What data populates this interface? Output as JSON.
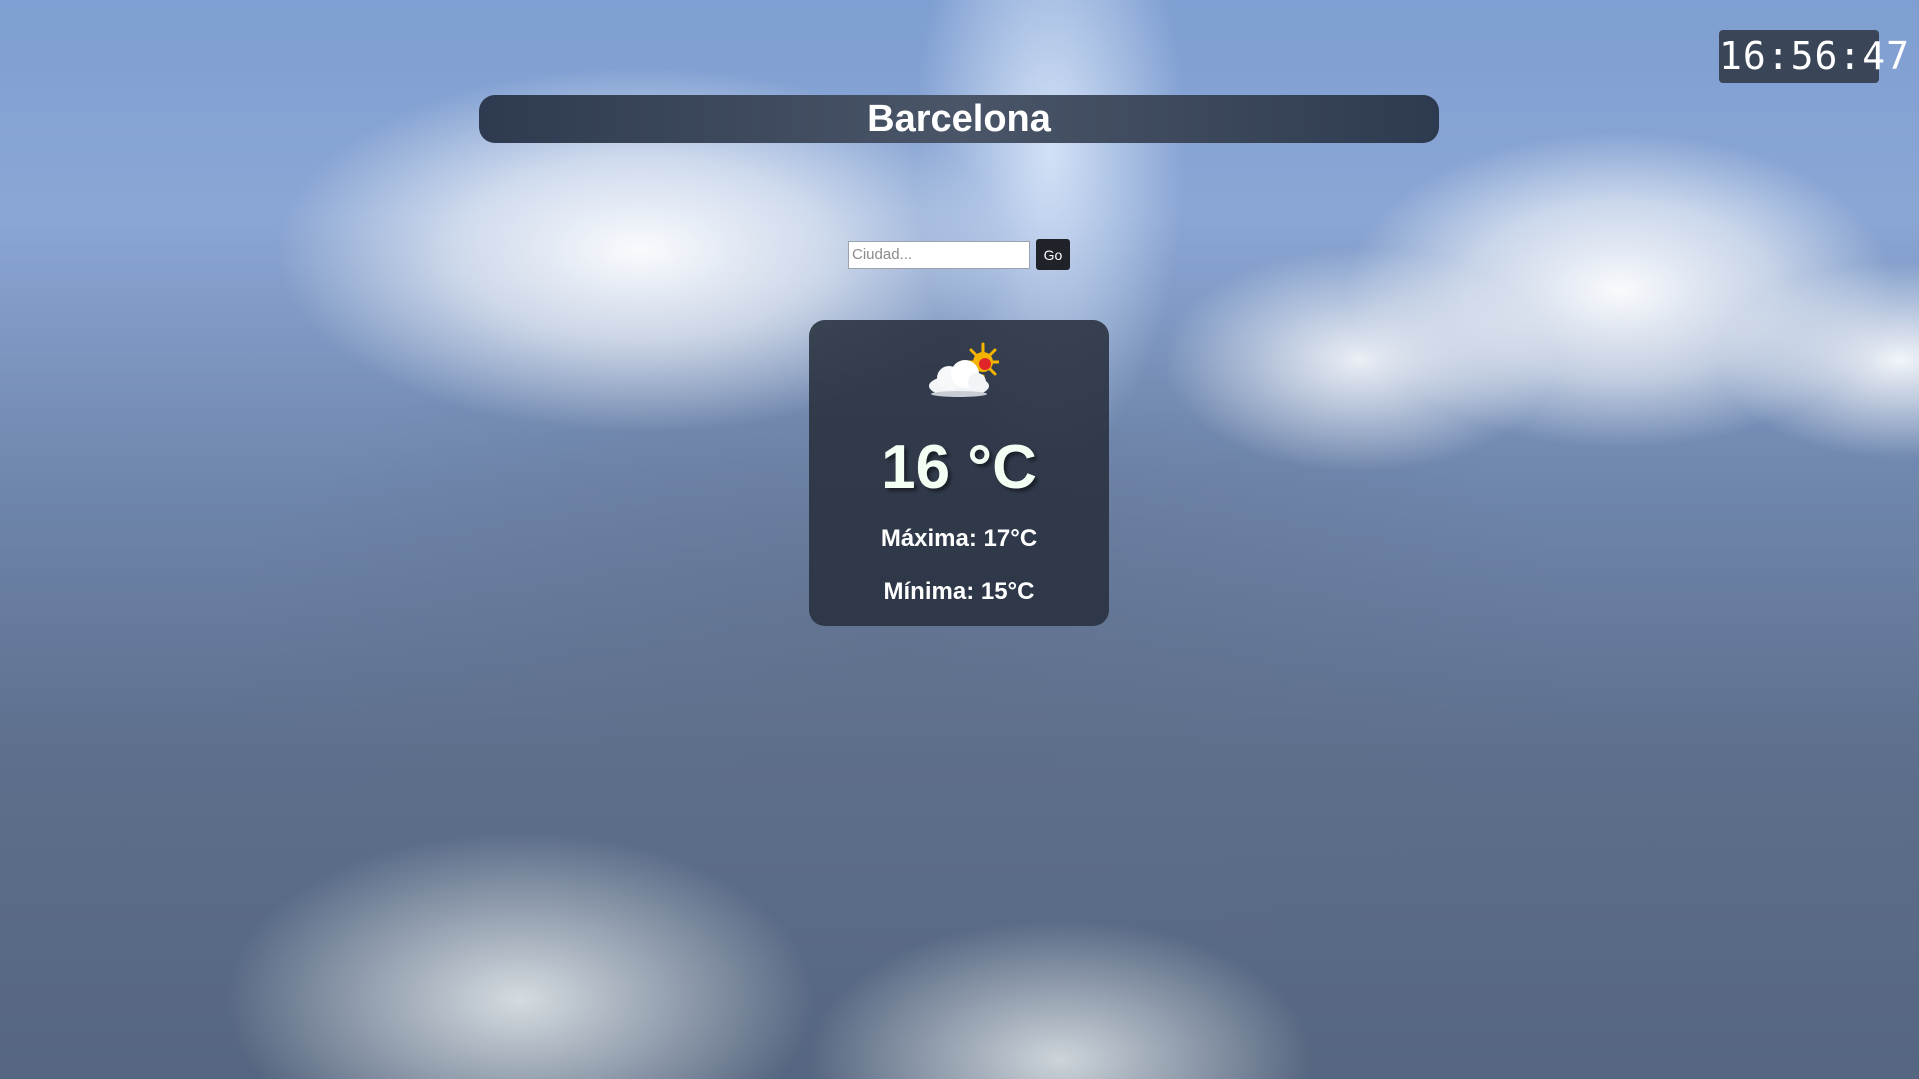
{
  "clock": {
    "time": "16:56:47"
  },
  "header": {
    "city": "Barcelona"
  },
  "search": {
    "placeholder": "Ciudad...",
    "value": "",
    "button_label": "Go"
  },
  "weather": {
    "icon": "partly-cloudy-sun-icon",
    "temperature": "16 °C",
    "max_label": "Máxima: 17°C",
    "min_label": "Mínima: 15°C"
  },
  "colors": {
    "card_background": "#28303e",
    "header_background": "#3a4658",
    "button_background": "#1f2329",
    "sun": "#f5b400",
    "sun_core": "#e0242a"
  }
}
